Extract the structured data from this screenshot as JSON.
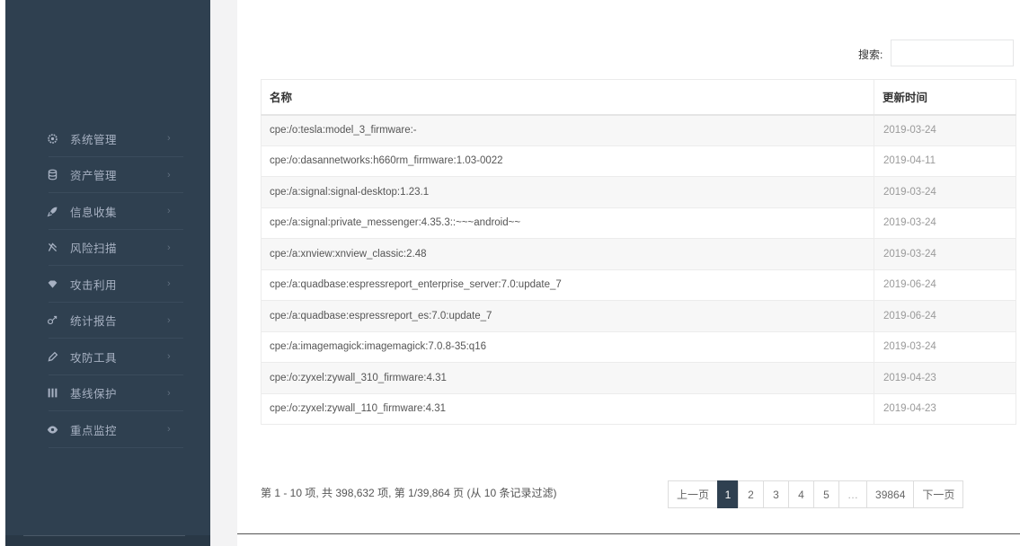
{
  "sidebar": {
    "items": [
      {
        "label": "系统管理",
        "icon": "gear-icon"
      },
      {
        "label": "资产管理",
        "icon": "database-icon"
      },
      {
        "label": "信息收集",
        "icon": "rocket-icon"
      },
      {
        "label": "风险扫描",
        "icon": "scan-icon"
      },
      {
        "label": "攻击利用",
        "icon": "diamond-icon"
      },
      {
        "label": "统计报告",
        "icon": "report-icon"
      },
      {
        "label": "攻防工具",
        "icon": "pencil-icon"
      },
      {
        "label": "基线保护",
        "icon": "columns-icon"
      },
      {
        "label": "重点监控",
        "icon": "eye-icon"
      }
    ],
    "chevron": "›"
  },
  "search": {
    "label": "搜索:",
    "value": ""
  },
  "table": {
    "headers": [
      "名称",
      "更新时间"
    ],
    "rows": [
      [
        "cpe:/o:tesla:model_3_firmware:-",
        "2019-03-24"
      ],
      [
        "cpe:/o:dasannetworks:h660rm_firmware:1.03-0022",
        "2019-04-11"
      ],
      [
        "cpe:/a:signal:signal-desktop:1.23.1",
        "2019-03-24"
      ],
      [
        "cpe:/a:signal:private_messenger:4.35.3::~~~android~~",
        "2019-03-24"
      ],
      [
        "cpe:/a:xnview:xnview_classic:2.48",
        "2019-03-24"
      ],
      [
        "cpe:/a:quadbase:espressreport_enterprise_server:7.0:update_7",
        "2019-06-24"
      ],
      [
        "cpe:/a:quadbase:espressreport_es:7.0:update_7",
        "2019-06-24"
      ],
      [
        "cpe:/a:imagemagick:imagemagick:7.0.8-35:q16",
        "2019-03-24"
      ],
      [
        "cpe:/o:zyxel:zywall_310_firmware:4.31",
        "2019-04-23"
      ],
      [
        "cpe:/o:zyxel:zywall_110_firmware:4.31",
        "2019-04-23"
      ]
    ]
  },
  "info": "第 1 - 10 项, 共 398,632 项, 第 1/39,864 页 (从 10 条记录过滤)",
  "pagination": {
    "prev": "上一页",
    "pages": [
      "1",
      "2",
      "3",
      "4",
      "5"
    ],
    "active": "1",
    "ellipsis": "…",
    "last": "39864",
    "next": "下一页"
  },
  "colors": {
    "sidebar": "#2f4050",
    "active_page": "#2f4050",
    "gutter": "#f3f3f4"
  }
}
